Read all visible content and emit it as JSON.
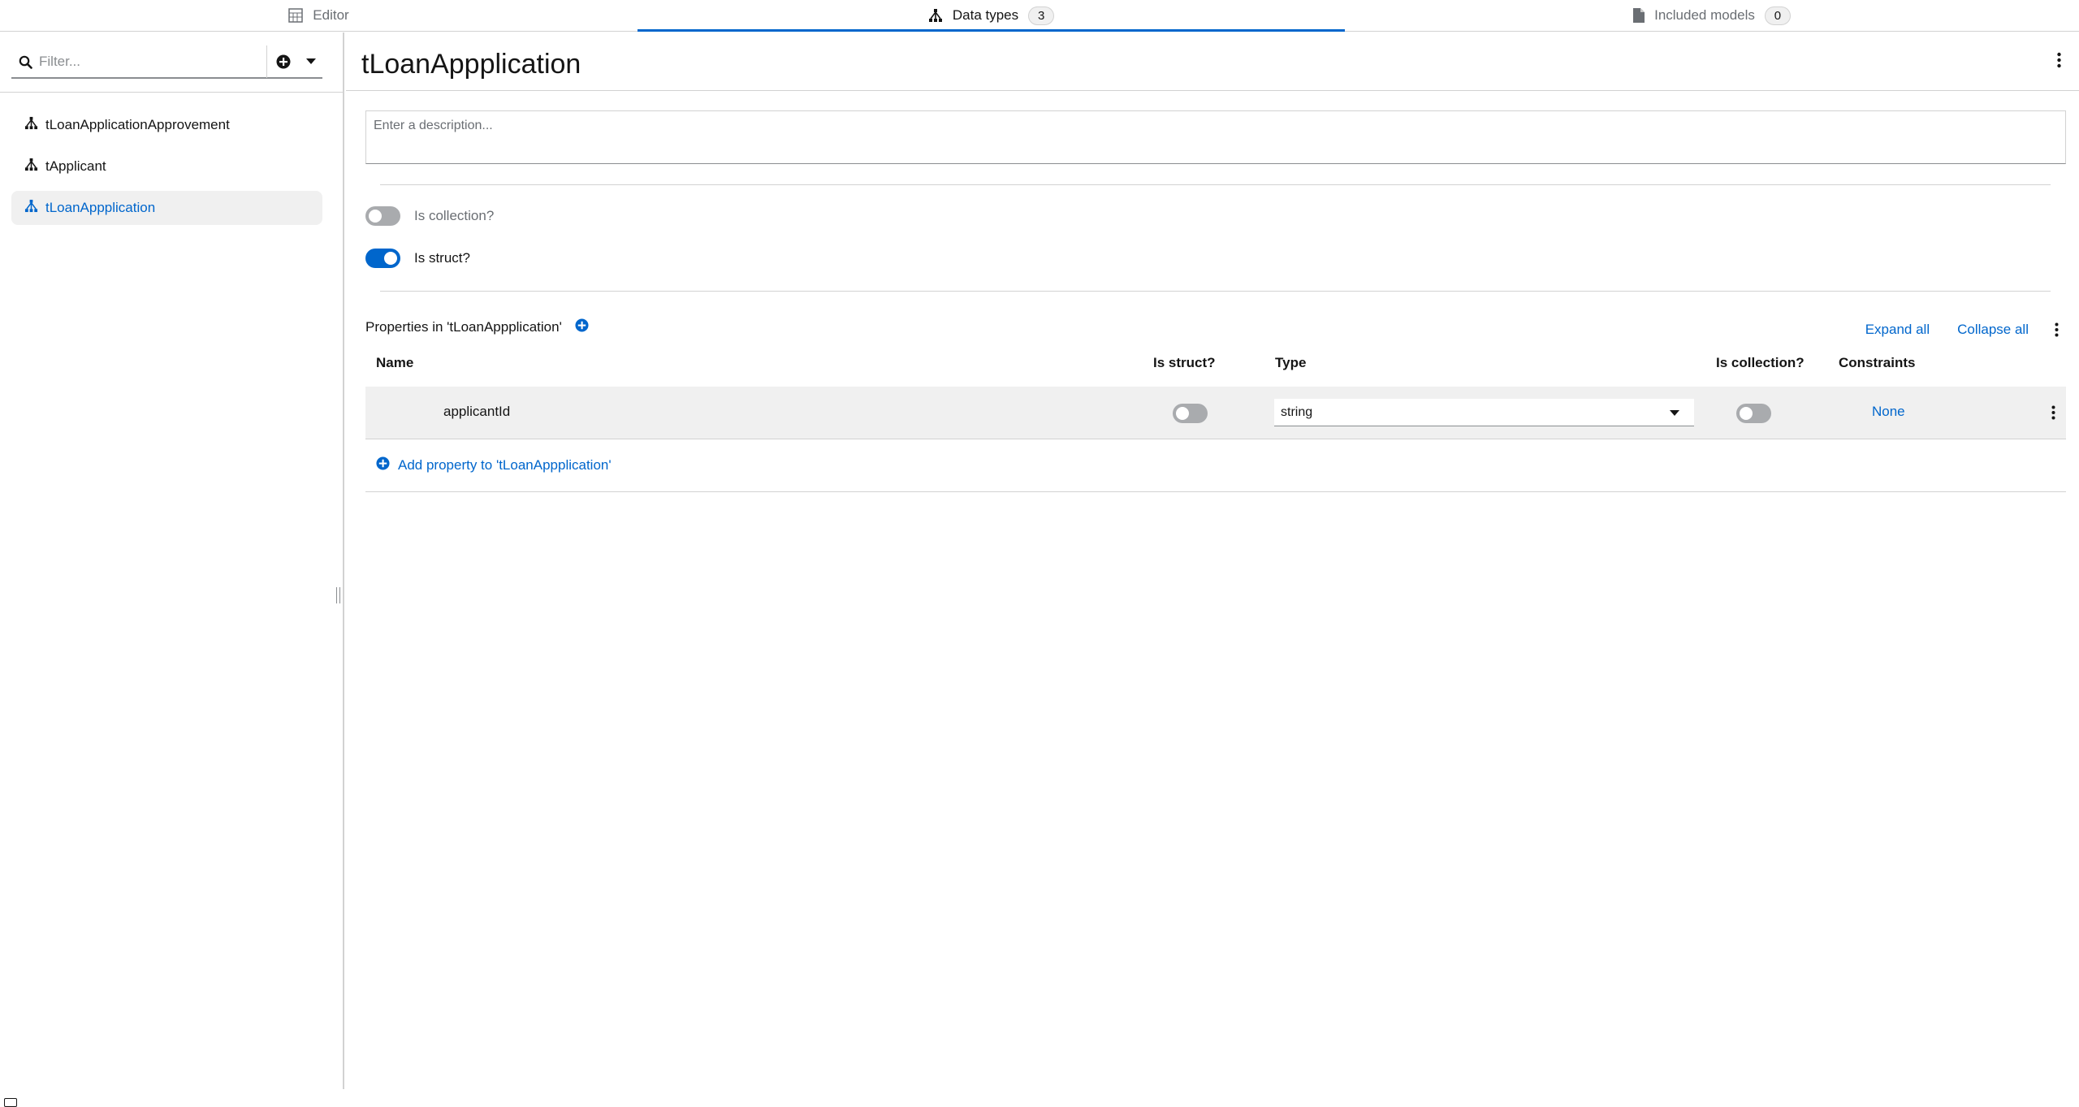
{
  "tabs": [
    {
      "label": "Editor",
      "icon": "editor-grid-icon",
      "badge": null,
      "active": false
    },
    {
      "label": "Data types",
      "icon": "data-types-icon",
      "badge": "3",
      "active": true
    },
    {
      "label": "Included models",
      "icon": "document-icon",
      "badge": "0",
      "active": false
    }
  ],
  "sidebar": {
    "filter_placeholder": "Filter...",
    "items": [
      {
        "label": "tLoanApplicationApprovement",
        "selected": false
      },
      {
        "label": "tApplicant",
        "selected": false
      },
      {
        "label": "tLoanAppplication",
        "selected": true
      }
    ]
  },
  "main": {
    "title": "tLoanAppplication",
    "description_placeholder": "Enter a description...",
    "is_collection_label": "Is collection?",
    "is_collection": false,
    "is_struct_label": "Is struct?",
    "is_struct": true,
    "properties": {
      "header": "Properties in 'tLoanAppplication'",
      "expand_all": "Expand all",
      "collapse_all": "Collapse all",
      "columns": {
        "name": "Name",
        "is_struct": "Is struct?",
        "type": "Type",
        "is_collection": "Is collection?",
        "constraints": "Constraints"
      },
      "rows": [
        {
          "name": "applicantId",
          "is_struct": false,
          "type": "string",
          "is_collection": false,
          "constraints": "None"
        }
      ],
      "add_label": "Add property to 'tLoanAppplication'"
    }
  },
  "colors": {
    "accent": "#0066cc",
    "border": "#d2d2d2",
    "row_bg": "#f0f0f0",
    "muted": "#6a6e73"
  }
}
